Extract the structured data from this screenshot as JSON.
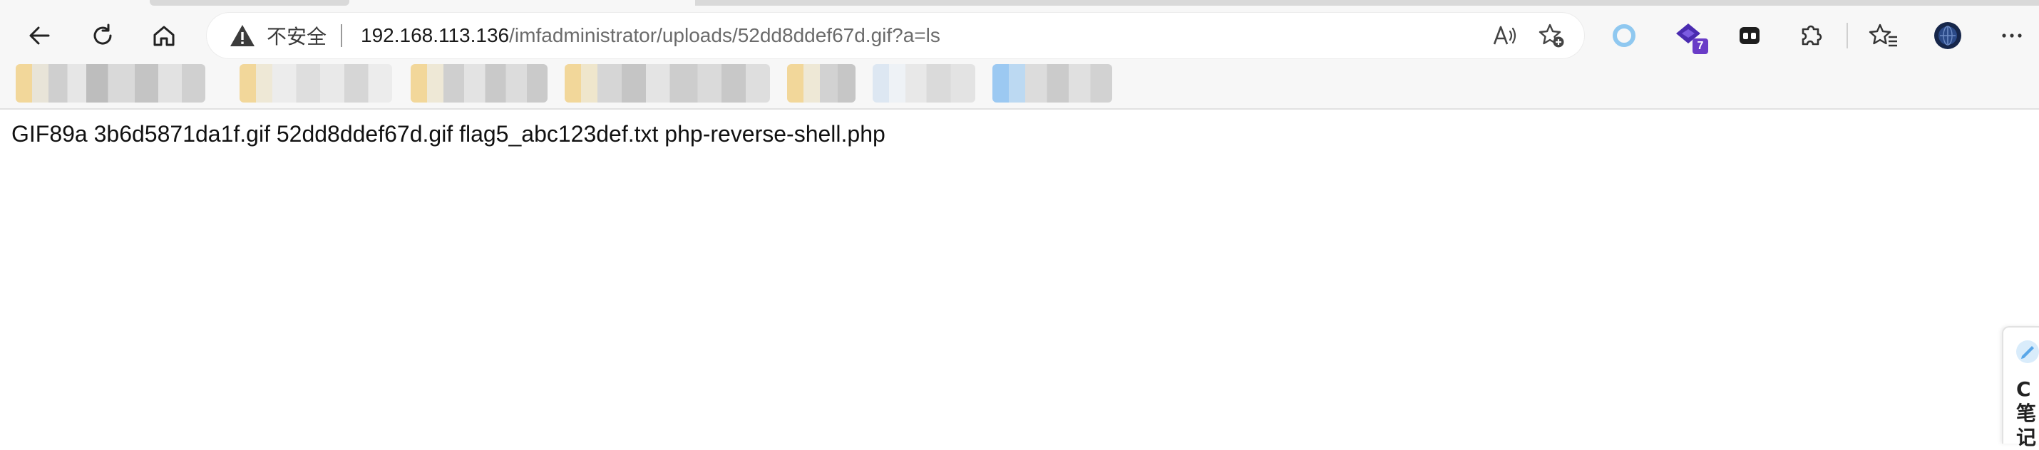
{
  "browser": {
    "security_label": "不安全",
    "url_host": "192.168.113.136",
    "url_path": "/imfadministrator/uploads/52dd8ddef67d.gif?a=ls",
    "extension_badge_count": "7",
    "icons": {
      "back": "back-arrow-icon",
      "refresh": "refresh-icon",
      "home": "home-icon",
      "warning": "warning-icon",
      "read_aloud": "read-aloud-icon",
      "add_favorite": "add-favorite-icon",
      "extensions": [
        "circle-extension-icon",
        "purple-extension-icon",
        "dark-extension-icon"
      ],
      "extensions_menu": "puzzle-icon",
      "favorites": "favorites-icon",
      "profile": "profile-avatar-icon",
      "more": "more-menu-icon"
    }
  },
  "bookmarks": [
    {
      "name": "bookmark-1",
      "color": "#f2d79a"
    },
    {
      "name": "bookmark-2",
      "color": "#f2d79a"
    },
    {
      "name": "bookmark-3",
      "color": "#f2d79a"
    },
    {
      "name": "bookmark-4",
      "color": "#f2d79a"
    },
    {
      "name": "bookmark-5",
      "color": "#f2d79a"
    },
    {
      "name": "bookmark-6",
      "color": "#dde7f2"
    },
    {
      "name": "bookmark-7",
      "color": "#9cc9f2"
    }
  ],
  "page": {
    "content": "GIF89a 3b6d5871da1f.gif 52dd8ddef67d.gif flag5_abc123def.txt php-reverse-shell.php"
  },
  "side_widget": {
    "text": "C笔记"
  }
}
